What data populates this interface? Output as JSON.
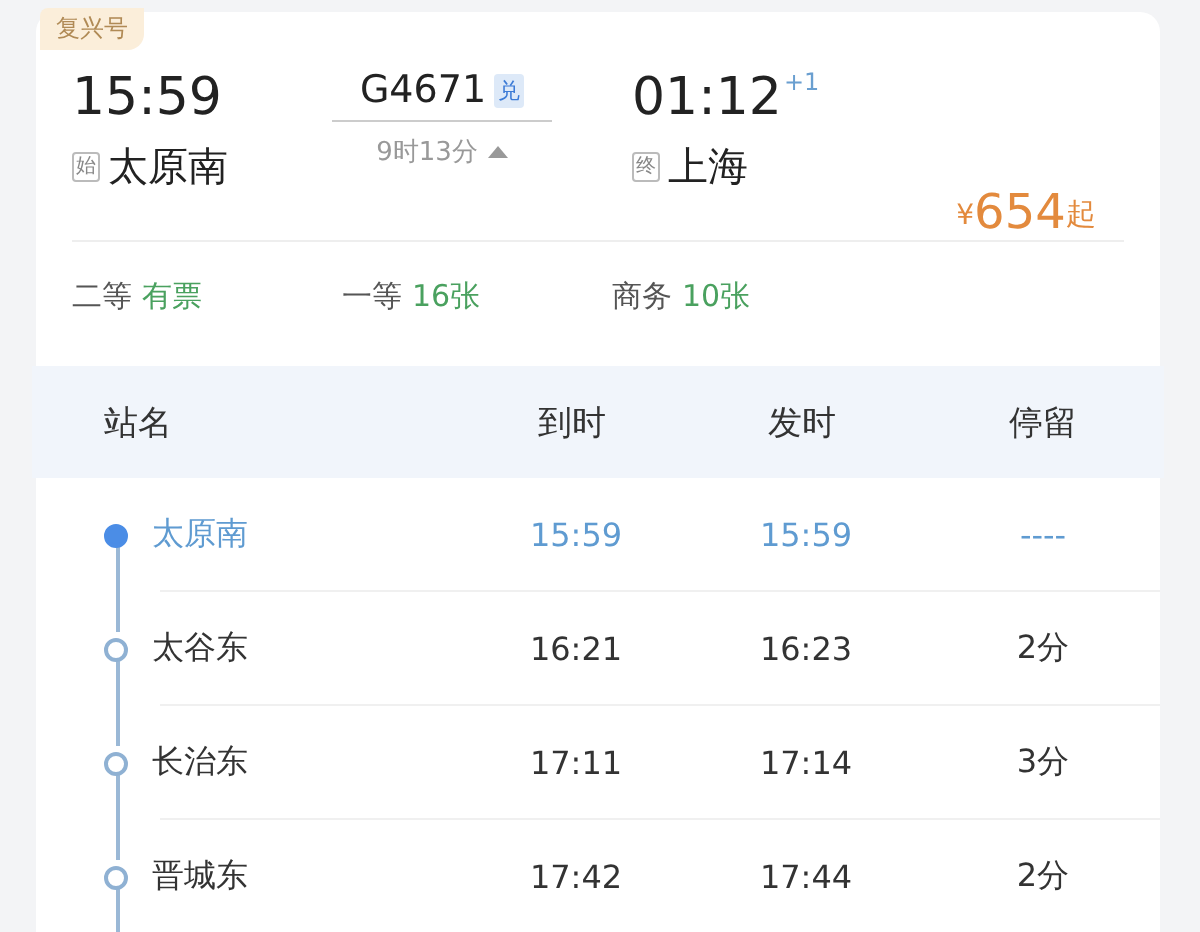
{
  "train_type": "复兴号",
  "departure": {
    "time": "15:59",
    "marker": "始",
    "station": "太原南"
  },
  "train": {
    "number": "G4671",
    "badge": "兑",
    "duration": "9时13分",
    "expanded": true
  },
  "arrival": {
    "time": "01:12",
    "day_offset": "+1",
    "marker": "终",
    "station": "上海"
  },
  "price": {
    "currency": "¥",
    "amount": "654",
    "suffix": "起"
  },
  "seats": [
    {
      "class": "二等",
      "availability": "有票"
    },
    {
      "class": "一等",
      "availability": "16张"
    },
    {
      "class": "商务",
      "availability": "10张"
    }
  ],
  "stops_table": {
    "columns": [
      "站名",
      "到时",
      "发时",
      "停留"
    ],
    "rows": [
      {
        "station": "太原南",
        "arrive": "15:59",
        "depart": "15:59",
        "stay": "----",
        "current": true
      },
      {
        "station": "太谷东",
        "arrive": "16:21",
        "depart": "16:23",
        "stay": "2分",
        "current": false
      },
      {
        "station": "长治东",
        "arrive": "17:11",
        "depart": "17:14",
        "stay": "3分",
        "current": false
      },
      {
        "station": "晋城东",
        "arrive": "17:42",
        "depart": "17:44",
        "stay": "2分",
        "current": false
      }
    ]
  }
}
